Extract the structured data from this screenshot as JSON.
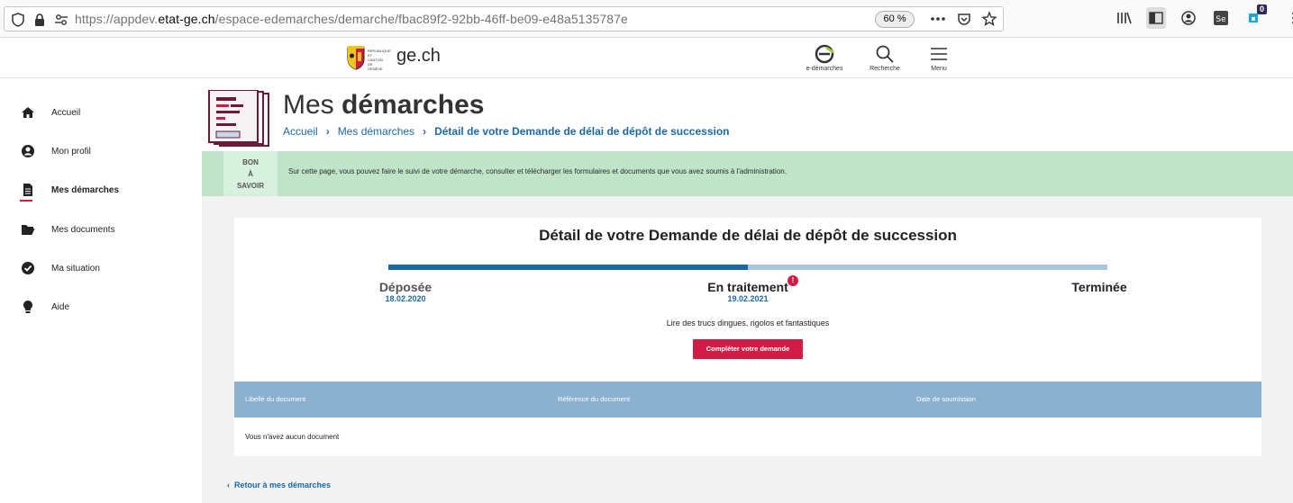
{
  "browser": {
    "url_prefix": "https://appdev.",
    "url_domain": "etat-ge.ch",
    "url_path": "/espace-edemarches/demarche/fbac89f2-92bb-46ff-be09-e48a5135787e",
    "zoom": "60 %",
    "notification_count": "0"
  },
  "header": {
    "site_name": "ge.ch",
    "crest_text": "RÉPUBLIQUE ET CANTON DE GENÈVE",
    "buttons": [
      {
        "label": "e-démarches",
        "icon": "e-demarches-icon"
      },
      {
        "label": "Recherche",
        "icon": "search-icon"
      },
      {
        "label": "Menu",
        "icon": "menu-icon"
      }
    ]
  },
  "sidebar": {
    "items": [
      {
        "label": "Accueil",
        "icon": "home-icon"
      },
      {
        "label": "Mon profil",
        "icon": "user-icon"
      },
      {
        "label": "Mes démarches",
        "icon": "document-icon",
        "active": true
      },
      {
        "label": "Mes documents",
        "icon": "folder-icon"
      },
      {
        "label": "Ma situation",
        "icon": "check-circle-icon"
      },
      {
        "label": "Aide",
        "icon": "bulb-icon"
      }
    ]
  },
  "page": {
    "title_light": "Mes ",
    "title_bold": "démarches",
    "breadcrumb": [
      "Accueil",
      "Mes démarches",
      "Détail de votre Demande de délai de dépôt de succession"
    ]
  },
  "info": {
    "tag_line1": "BON",
    "tag_line2": "À",
    "tag_line3": "SAVOIR",
    "text": "Sur cette page, vous pouvez faire le suivi de votre démarche, consulter et télécharger les formulaires et documents que vous avez soumis à l'administration."
  },
  "detail": {
    "title": "Détail de votre Demande de délai de dépôt de succession",
    "progress_fraction": 0.5,
    "steps": [
      {
        "label": "Déposée",
        "date": "18.02.2020",
        "color": "#555555"
      },
      {
        "label": "En traitement",
        "date": "19.02.2021",
        "color": "#222222",
        "alert": "!"
      },
      {
        "label": "Terminée",
        "date": "",
        "color": "#222222"
      }
    ],
    "note": "Lire des trucs dingues, rigolos et fantastiques",
    "cta": "Compléter votre demande"
  },
  "documents_table": {
    "columns": [
      "Libellé du document",
      "Référence du document",
      "Date de soumission"
    ],
    "empty_message": "Vous n'avez aucun document"
  },
  "back_link": "Retour à mes démarches",
  "colors": {
    "accent_blue": "#1b6aa5",
    "accent_red": "#d11d45",
    "info_green": "#bfe4c8",
    "table_header": "#8cb1ce"
  }
}
